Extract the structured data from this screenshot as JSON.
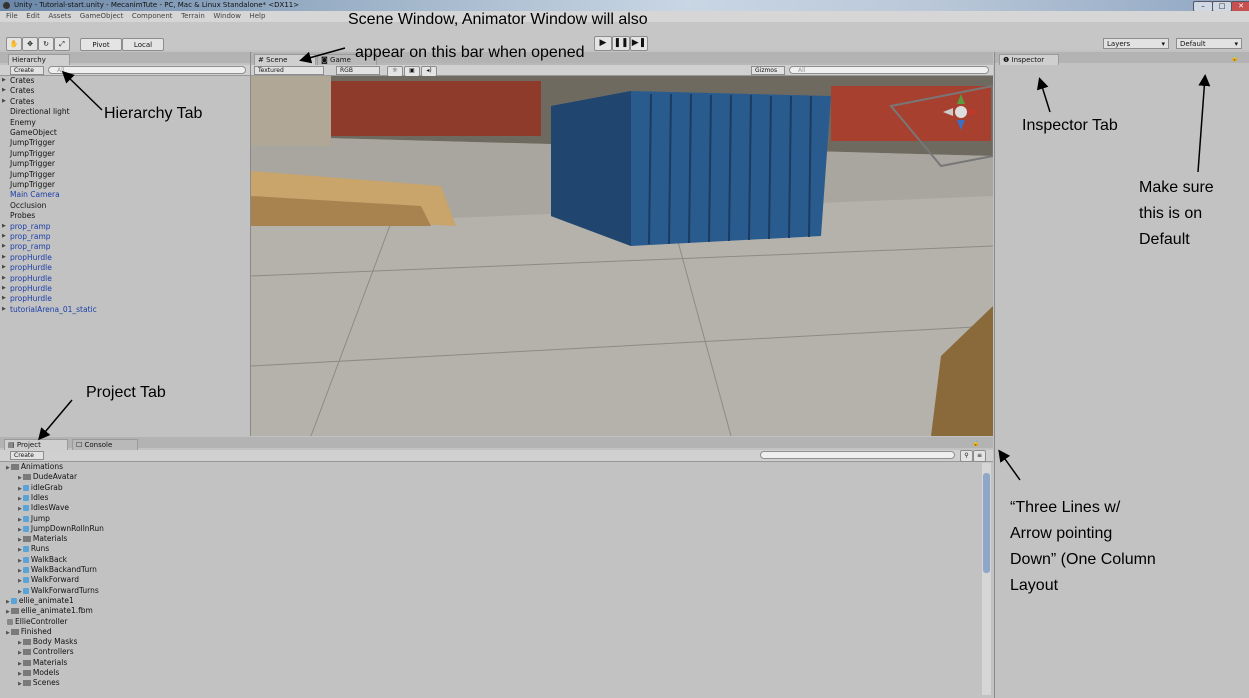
{
  "window": {
    "title": "Unity - Tutorial-start.unity - MecanimTute - PC, Mac & Linux Standalone* <DX11>",
    "controls": [
      "–",
      "□",
      "✕"
    ]
  },
  "menu": [
    "File",
    "Edit",
    "Assets",
    "GameObject",
    "Component",
    "Terrain",
    "Window",
    "Help"
  ],
  "toolbar": {
    "pivot": "Pivot",
    "local": "Local",
    "layers": "Layers",
    "layout": "Default"
  },
  "hierarchy": {
    "tab": "Hierarchy",
    "create": "Create",
    "search_placeholder": "All",
    "items": [
      {
        "label": "Crates",
        "blue": false,
        "arrow": true
      },
      {
        "label": "Crates",
        "blue": false,
        "arrow": true
      },
      {
        "label": "Crates",
        "blue": false,
        "arrow": true
      },
      {
        "label": "Directional light",
        "blue": false,
        "arrow": false
      },
      {
        "label": "Enemy",
        "blue": false,
        "arrow": false
      },
      {
        "label": "GameObject",
        "blue": false,
        "arrow": false
      },
      {
        "label": "JumpTrigger",
        "blue": false,
        "arrow": false
      },
      {
        "label": "JumpTrigger",
        "blue": false,
        "arrow": false
      },
      {
        "label": "JumpTrigger",
        "blue": false,
        "arrow": false
      },
      {
        "label": "JumpTrigger",
        "blue": false,
        "arrow": false
      },
      {
        "label": "JumpTrigger",
        "blue": false,
        "arrow": false
      },
      {
        "label": "Main Camera",
        "blue": true,
        "arrow": false
      },
      {
        "label": "Occlusion",
        "blue": false,
        "arrow": false
      },
      {
        "label": "Probes",
        "blue": false,
        "arrow": false
      },
      {
        "label": "prop_ramp",
        "blue": true,
        "arrow": true
      },
      {
        "label": "prop_ramp",
        "blue": true,
        "arrow": true
      },
      {
        "label": "prop_ramp",
        "blue": true,
        "arrow": true
      },
      {
        "label": "propHurdle",
        "blue": true,
        "arrow": true
      },
      {
        "label": "propHurdle",
        "blue": true,
        "arrow": true
      },
      {
        "label": "propHurdle",
        "blue": true,
        "arrow": true
      },
      {
        "label": "propHurdle",
        "blue": true,
        "arrow": true
      },
      {
        "label": "propHurdle",
        "blue": true,
        "arrow": true
      },
      {
        "label": "tutorialArena_01_static",
        "blue": true,
        "arrow": true
      }
    ]
  },
  "scene": {
    "tab_scene": "Scene",
    "tab_game": "Game",
    "shading": "Textured",
    "rgb": "RGB",
    "gizmos": "Gizmos",
    "search_placeholder": "All"
  },
  "inspector": {
    "tab": "Inspector"
  },
  "project": {
    "tab": "Project",
    "tab_console": "Console",
    "create": "Create",
    "items": [
      {
        "label": "Animations",
        "indent": 0,
        "kind": "folder"
      },
      {
        "label": "DudeAvatar",
        "indent": 1,
        "kind": "folder"
      },
      {
        "label": "idleGrab",
        "indent": 1,
        "kind": "anim"
      },
      {
        "label": "Idles",
        "indent": 1,
        "kind": "anim"
      },
      {
        "label": "IdlesWave",
        "indent": 1,
        "kind": "anim"
      },
      {
        "label": "Jump",
        "indent": 1,
        "kind": "anim"
      },
      {
        "label": "JumpDownRollnRun",
        "indent": 1,
        "kind": "anim"
      },
      {
        "label": "Materials",
        "indent": 1,
        "kind": "folder"
      },
      {
        "label": "Runs",
        "indent": 1,
        "kind": "anim"
      },
      {
        "label": "WalkBack",
        "indent": 1,
        "kind": "anim"
      },
      {
        "label": "WalkBackandTurn",
        "indent": 1,
        "kind": "anim"
      },
      {
        "label": "WalkForward",
        "indent": 1,
        "kind": "anim"
      },
      {
        "label": "WalkForwardTurns",
        "indent": 1,
        "kind": "anim"
      },
      {
        "label": "ellie_animate1",
        "indent": 0,
        "kind": "anim"
      },
      {
        "label": "ellie_animate1.fbm",
        "indent": 0,
        "kind": "folder"
      },
      {
        "label": "EllieController",
        "indent": 0,
        "kind": "controller"
      },
      {
        "label": "Finished",
        "indent": 0,
        "kind": "folder"
      },
      {
        "label": "Body Masks",
        "indent": 1,
        "kind": "folder"
      },
      {
        "label": "Controllers",
        "indent": 1,
        "kind": "folder"
      },
      {
        "label": "Materials",
        "indent": 1,
        "kind": "folder"
      },
      {
        "label": "Models",
        "indent": 1,
        "kind": "folder"
      },
      {
        "label": "Scenes",
        "indent": 1,
        "kind": "folder"
      }
    ]
  },
  "annotations": {
    "scene_line1": "Scene Window, Animator Window will also",
    "scene_line2": "appear on this bar when opened",
    "hierarchy": "Hierarchy Tab",
    "inspector": "Inspector Tab",
    "default_1": "Make sure",
    "default_2": "this is on",
    "default_3": "Default",
    "project": "Project Tab",
    "lines_1": "“Three Lines w/",
    "lines_2": "Arrow pointing",
    "lines_3": "Down” (One Column",
    "lines_4": "Layout"
  }
}
